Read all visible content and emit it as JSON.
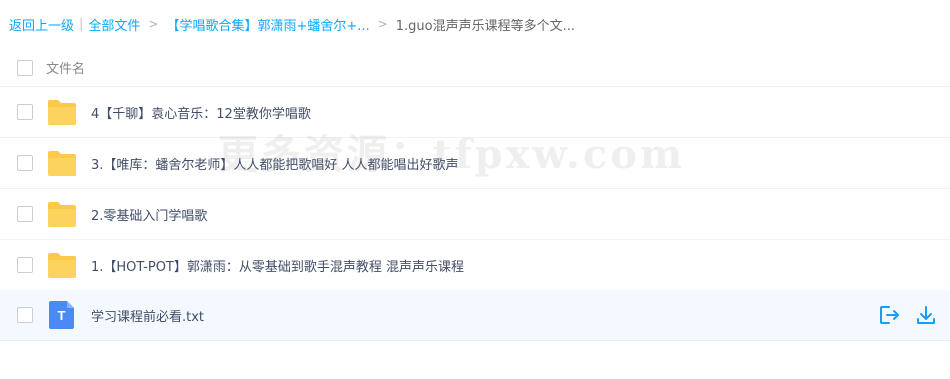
{
  "breadcrumb": {
    "back_label": "返回上一级",
    "separator": "|",
    "all_files_label": "全部文件",
    "arrow": ">",
    "folder1_label": "【学唱歌合集】郭潇雨+蟠舍尔+...",
    "current_label": "1.guo混声声乐课程等多个文..."
  },
  "header": {
    "name_column_label": "文件名"
  },
  "files": [
    {
      "name": "4【千聊】袁心音乐：12堂教你学唱歌",
      "type": "folder"
    },
    {
      "name": "3.【唯库：蟠舍尔老师】人人都能把歌唱好 人人都能唱出好歌声",
      "type": "folder"
    },
    {
      "name": "2.零基础入门学唱歌",
      "type": "folder"
    },
    {
      "name": "1.【HOT-POT】郭潇雨：从零基础到歌手混声教程 混声声乐课程",
      "type": "folder"
    },
    {
      "name": "学习课程前必看.txt",
      "type": "txt",
      "file_icon_letter": "T"
    }
  ],
  "watermark": "更多资源：tfpxw.com",
  "colors": {
    "accent": "#09aaff",
    "folder": "#fcc94b",
    "txt_icon": "#4a8af4",
    "selected_row": "#f3f9ff"
  }
}
